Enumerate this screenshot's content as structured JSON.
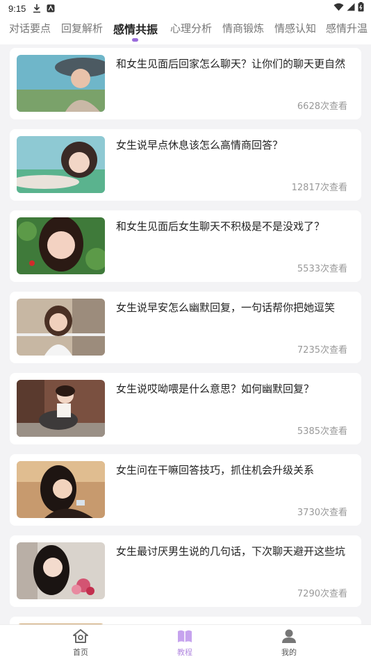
{
  "status_bar": {
    "time": "9:15"
  },
  "tabs": [
    {
      "label": "对话要点"
    },
    {
      "label": "回复解析"
    },
    {
      "label": "感情共振"
    },
    {
      "label": "心理分析"
    },
    {
      "label": "情商锻炼"
    },
    {
      "label": "情感认知"
    },
    {
      "label": "感情升温"
    }
  ],
  "active_tab": "感情共振",
  "articles": [
    {
      "title": "和女生见面后回家怎么聊天？让你们的聊天更自然",
      "views": "6628次查看"
    },
    {
      "title": "女生说早点休息该怎么高情商回答？",
      "views": "12817次查看"
    },
    {
      "title": "和女生见面后女生聊天不积极是不是没戏了？",
      "views": "5533次查看"
    },
    {
      "title": "女生说早安怎么幽默回复，一句话帮你把她逗笑",
      "views": "7235次查看"
    },
    {
      "title": "女生说哎呦喂是什么意思？如何幽默回复？",
      "views": "5385次查看"
    },
    {
      "title": "女生问在干嘛回答技巧，抓住机会升级关系",
      "views": "3730次查看"
    },
    {
      "title": "女生最讨厌男生说的几句话，下次聊天避开这些坑",
      "views": "7290次查看"
    }
  ],
  "bottom_nav": [
    {
      "label": "首页",
      "icon": "home-icon"
    },
    {
      "label": "教程",
      "icon": "book-icon"
    },
    {
      "label": "我的",
      "icon": "profile-icon"
    }
  ],
  "colors": {
    "accent": "#9a6cdc",
    "nav_active": "#b38ae0",
    "background": "#f3f3f5"
  }
}
